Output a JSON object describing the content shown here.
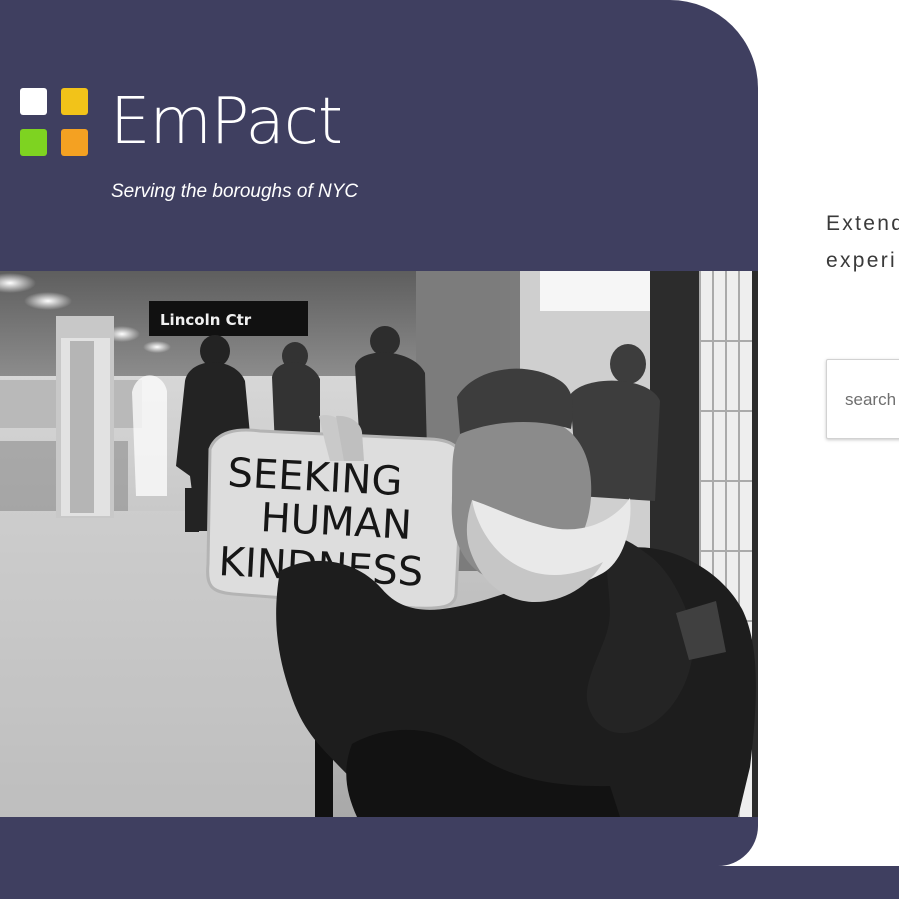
{
  "brand": {
    "name": "EmPact",
    "tagline": "Serving the boroughs of NYC",
    "logo_colors": [
      "#ffffff",
      "#f2c319",
      "#7ed321",
      "#f4a122"
    ]
  },
  "hero": {
    "image": "photograph",
    "sign_text": {
      "line1": "SEEKING",
      "line2": "HUMAN",
      "line3": "KINDNESS"
    },
    "station_sign": "Lincoln Ctr"
  },
  "intro": {
    "line1": "Extend",
    "line2": "experi"
  },
  "search": {
    "placeholder": "search"
  },
  "colors": {
    "primary_panel": "#3f3f60",
    "background": "#ffffff"
  }
}
